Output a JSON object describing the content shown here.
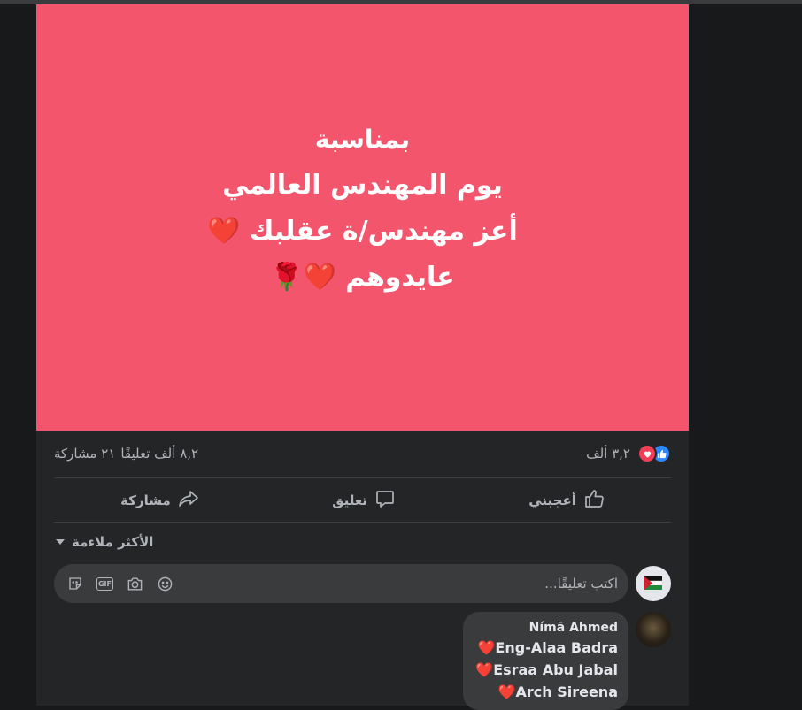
{
  "post": {
    "image_lines": [
      "بمناسبة",
      "يوم المهندس العالمي",
      "أعز مهندس/ة عقلبك ❤️",
      "عايدوهم ❤️🌹"
    ],
    "background_color": "#f3566c"
  },
  "stats": {
    "reactions_count": "٣,٢ ألف",
    "comments_count": "٨,٢ ألف تعليقًا",
    "shares_count": "٢١ مشاركة"
  },
  "actions": {
    "like_label": "أعجبني",
    "comment_label": "تعليق",
    "share_label": "مشاركة"
  },
  "comments": {
    "sort_label": "الأكثر ملاءمة",
    "input_placeholder": "اكتب تعليقًا...",
    "items": [
      {
        "author": "Nímā Ahmed",
        "mentions": [
          "❤️Eng-Alaa Badra",
          "❤️Esraa Abu Jabal",
          "❤️Arch Sireena"
        ]
      }
    ]
  },
  "colors": {
    "background": "#18191a",
    "card": "#242526",
    "like_blue": "#2d88ff",
    "love_red": "#f33e58"
  }
}
